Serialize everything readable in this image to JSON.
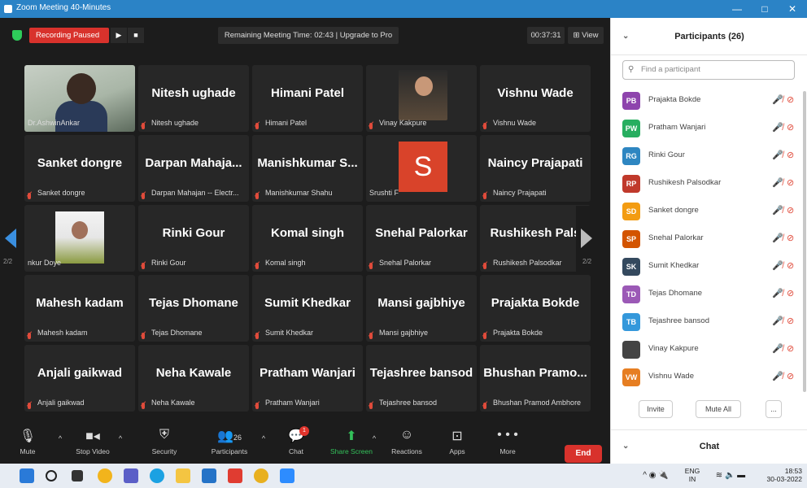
{
  "window": {
    "title": "Zoom Meeting 40-Minutes",
    "min": "—",
    "max": "□",
    "close": "✕"
  },
  "topbar": {
    "recording": "Recording Paused",
    "play": "▶",
    "stop": "■",
    "remaining": "Remaining Meeting Time: 02:43 | Upgrade to Pro",
    "timer": "00:37:31",
    "view": "View"
  },
  "tiles": [
    {
      "big": "",
      "small": "Dr.AshwinAnkar",
      "type": "photo-man"
    },
    {
      "big": "Nitesh ughade",
      "small": "Nitesh ughade"
    },
    {
      "big": "Himani Patel",
      "small": "Himani Patel"
    },
    {
      "big": "",
      "small": "Vinay Kakpure",
      "type": "photo-vinay"
    },
    {
      "big": "Vishnu Wade",
      "small": "Vishnu Wade"
    },
    {
      "big": "Sanket dongre",
      "small": "Sanket dongre"
    },
    {
      "big": "Darpan  Mahaja...",
      "small": "Darpan Mahajan -- Electr..."
    },
    {
      "big": "Manishkumar  S...",
      "small": "Manishkumar Shahu"
    },
    {
      "big": "",
      "small": "Srushti F",
      "type": "avatar-s",
      "avatar": "S"
    },
    {
      "big": "Naincy Prajapati",
      "small": "Naincy Prajapati"
    },
    {
      "big": "",
      "small": "nkur Doye",
      "type": "photo-ankur"
    },
    {
      "big": "Rinki Gour",
      "small": "Rinki Gour"
    },
    {
      "big": "Komal singh",
      "small": "Komal singh"
    },
    {
      "big": "Snehal Palorkar",
      "small": "Snehal Palorkar"
    },
    {
      "big": "Rushikesh  Pals",
      "small": "Rushikesh Palsodkar"
    },
    {
      "big": "Mahesh kadam",
      "small": "Mahesh kadam"
    },
    {
      "big": "Tejas Dhomane",
      "small": "Tejas Dhomane"
    },
    {
      "big": "Sumit Khedkar",
      "small": "Sumit Khedkar"
    },
    {
      "big": "Mansi gajbhiye",
      "small": "Mansi gajbhiye"
    },
    {
      "big": "Prajakta Bokde",
      "small": "Prajakta Bokde"
    },
    {
      "big": "Anjali gaikwad",
      "small": "Anjali gaikwad"
    },
    {
      "big": "Neha Kawale",
      "small": "Neha Kawale"
    },
    {
      "big": "Pratham Wanjari",
      "small": "Pratham Wanjari"
    },
    {
      "big": "Tejashree bansod",
      "small": "Tejashree bansod"
    },
    {
      "big": "Bhushan  Pramo...",
      "small": "Bhushan Pramod Ambhore"
    }
  ],
  "nav": {
    "page_left": "2/2",
    "page_right": "2/2"
  },
  "toolbar": {
    "mute": "Mute",
    "video": "Stop Video",
    "security": "Security",
    "participants": "Participants",
    "participants_count": "26",
    "chat": "Chat",
    "chat_badge": "1",
    "share": "Share Screen",
    "reactions": "Reactions",
    "apps": "Apps",
    "more": "More",
    "more_icon": "• • •",
    "end": "End"
  },
  "panel": {
    "title": "Participants (26)",
    "search_placeholder": "Find a participant",
    "participants": [
      {
        "initials": "PB",
        "name": "Prajakta Bokde",
        "color": "#8e44ad"
      },
      {
        "initials": "PW",
        "name": "Pratham Wanjari",
        "color": "#27ae60"
      },
      {
        "initials": "RG",
        "name": "Rinki Gour",
        "color": "#2e86c1"
      },
      {
        "initials": "RP",
        "name": "Rushikesh Palsodkar",
        "color": "#c0392b"
      },
      {
        "initials": "SD",
        "name": "Sanket dongre",
        "color": "#f39c12"
      },
      {
        "initials": "SP",
        "name": "Snehal Palorkar",
        "color": "#d35400"
      },
      {
        "initials": "SK",
        "name": "Sumit Khedkar",
        "color": "#34495e"
      },
      {
        "initials": "TD",
        "name": "Tejas Dhomane",
        "color": "#9b59b6"
      },
      {
        "initials": "TB",
        "name": "Tejashree bansod",
        "color": "#3498db"
      },
      {
        "initials": "",
        "name": "Vinay Kakpure",
        "color": "#444444"
      },
      {
        "initials": "VW",
        "name": "Vishnu Wade",
        "color": "#e67e22"
      }
    ],
    "invite": "Invite",
    "mute_all": "Mute All",
    "more": "...",
    "chat_title": "Chat"
  },
  "taskbar": {
    "lang1": "ENG",
    "lang2": "IN",
    "time": "18:53",
    "date": "30-03-2022"
  }
}
